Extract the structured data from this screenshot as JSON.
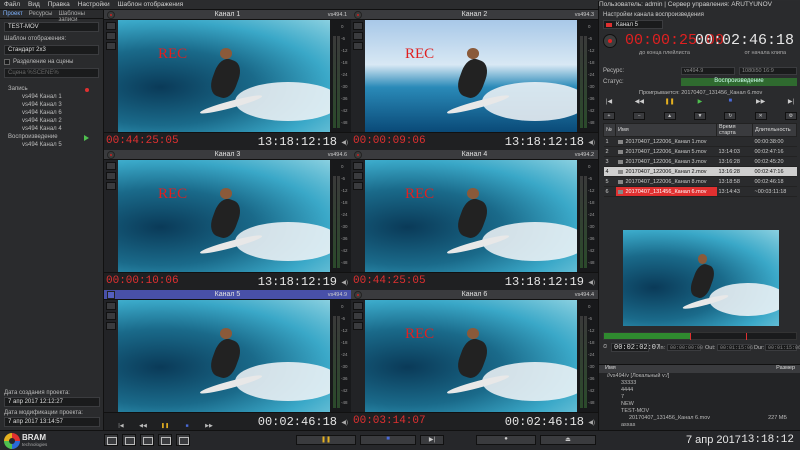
{
  "menu": [
    "Файл",
    "Вид",
    "Правка",
    "Настройки",
    "Шаблон отображения"
  ],
  "menu_right": "Пользователь: admin  |  Сервер управления: ARUTYUNOV",
  "left": {
    "tabs": [
      "Проект",
      "Ресурсы",
      "Шаблоны записи"
    ],
    "project_name": "TEST-MOV",
    "template_label": "Шаблон отображения:",
    "template_value": "Стандарт 2x3",
    "split_label": "Разделение на сцены",
    "scene_placeholder": "Сцена %SCENE%",
    "tree": [
      {
        "label": "Запись",
        "child": false,
        "icon": "rec"
      },
      {
        "label": "vs494 Канал 1",
        "child": true
      },
      {
        "label": "vs494 Канал 3",
        "child": true
      },
      {
        "label": "vs494 Канал 6",
        "child": true
      },
      {
        "label": "vs494 Канал 2",
        "child": true
      },
      {
        "label": "vs494 Канал 4",
        "child": true
      },
      {
        "label": "Воспроизведение",
        "child": false,
        "icon": "play"
      },
      {
        "label": "vs494 Канал 5",
        "child": true
      }
    ],
    "created_label": "Дата создания проекта:",
    "created_value": "7 апр 2017 12:12:27",
    "modified_label": "Дата модификации проекта:",
    "modified_value": "7 апр 2017 13:14:57"
  },
  "channels": [
    {
      "name": "Канал 1",
      "vs": "vs494.1",
      "rec": "REC",
      "tc_left": "00:44:25:05",
      "tc_right": "13:18:12:18"
    },
    {
      "name": "Канал 2",
      "vs": "vs494.3",
      "rec": "REC",
      "tc_left": "00:00:09:06",
      "tc_right": "13:18:12:18"
    },
    {
      "name": "Канал 3",
      "vs": "vs494.6",
      "rec": "REC",
      "tc_left": "00:00:10:06",
      "tc_right": "13:18:12:19"
    },
    {
      "name": "Канал 4",
      "vs": "vs494.2",
      "rec": "REC",
      "tc_left": "00:44:25:05",
      "tc_right": "13:18:12:19"
    },
    {
      "name": "Канал 5",
      "vs": "vs494.9",
      "rec": "",
      "tc_left": "",
      "tc_right": "00:02:46:18"
    },
    {
      "name": "Канал 6",
      "vs": "vs494.4",
      "rec": "REC",
      "tc_left": "00:03:14:07",
      "tc_right": "00:02:46:18"
    }
  ],
  "meter_scale": [
    "0",
    "-6",
    "-12",
    "-18",
    "-24",
    "-30",
    "-36",
    "-42",
    "-48"
  ],
  "right": {
    "title": "Настройки канала воспроизведения",
    "channel": "Канал 5",
    "tc_remaining": "00:00:25:00",
    "tc_clip": "00:02:46:18",
    "tc_remaining_label": "до конца плейлиста",
    "tc_clip_label": "от начала клипа",
    "resource_label": "Ресурс:",
    "resource_value": "vs494.9",
    "format_value": "1080i50 16:9",
    "status_label": "Статус:",
    "status_value": "Воспроизведение",
    "playing_label": "Проигрывается: 20170407_131456_Канал 6.mov",
    "playlist_headers": [
      "№",
      "Имя",
      "Время старта",
      "Длительность"
    ],
    "playlist": [
      {
        "n": "1",
        "name": "20170407_122006_Канал 1.mov",
        "start": "",
        "dur": "00:00:38:00"
      },
      {
        "n": "2",
        "name": "20170407_122006_Канал 5.mov",
        "start": "13:14:03",
        "dur": "00:02:47:16"
      },
      {
        "n": "3",
        "name": "20170407_122006_Канал 3.mov",
        "start": "13:16:28",
        "dur": "00:02:45:20"
      },
      {
        "n": "4",
        "name": "20170407_122006_Канал 2.mov",
        "start": "13:16:28",
        "dur": "00:02:47:16"
      },
      {
        "n": "5",
        "name": "20170407_122006_Канал 8.mov",
        "start": "13:18:58",
        "dur": "00:02:46:18"
      },
      {
        "n": "6",
        "name": "20170407_131456_Канал 6.mov",
        "start": "13:14:43",
        "dur": "~00:03:11:18"
      }
    ],
    "tc_in": "00:02:02:07",
    "in_label": "In:",
    "in_value": "00:00:00:00",
    "out_label": "Out:",
    "out_value": "00:01:15:06",
    "dur_label": "Dur:",
    "dur_value": "00:01:15:06",
    "browser_headers": [
      "Имя",
      "Размер"
    ],
    "browser": [
      {
        "label": "//vs494/v [Локальный v:/]",
        "size": ""
      },
      {
        "label": "33333",
        "size": ""
      },
      {
        "label": "4444",
        "size": ""
      },
      {
        "label": "7",
        "size": ""
      },
      {
        "label": "NEW",
        "size": ""
      },
      {
        "label": "TEST-MOV",
        "size": ""
      },
      {
        "label": "20170407_131456_Канал 6.mov",
        "size": "227 МБ"
      },
      {
        "label": "asxas",
        "size": ""
      }
    ]
  },
  "bottom": {
    "brand": "BRAM",
    "brand_sub": "technologies",
    "date": "7 апр 2017",
    "clock": "13:18:12"
  }
}
